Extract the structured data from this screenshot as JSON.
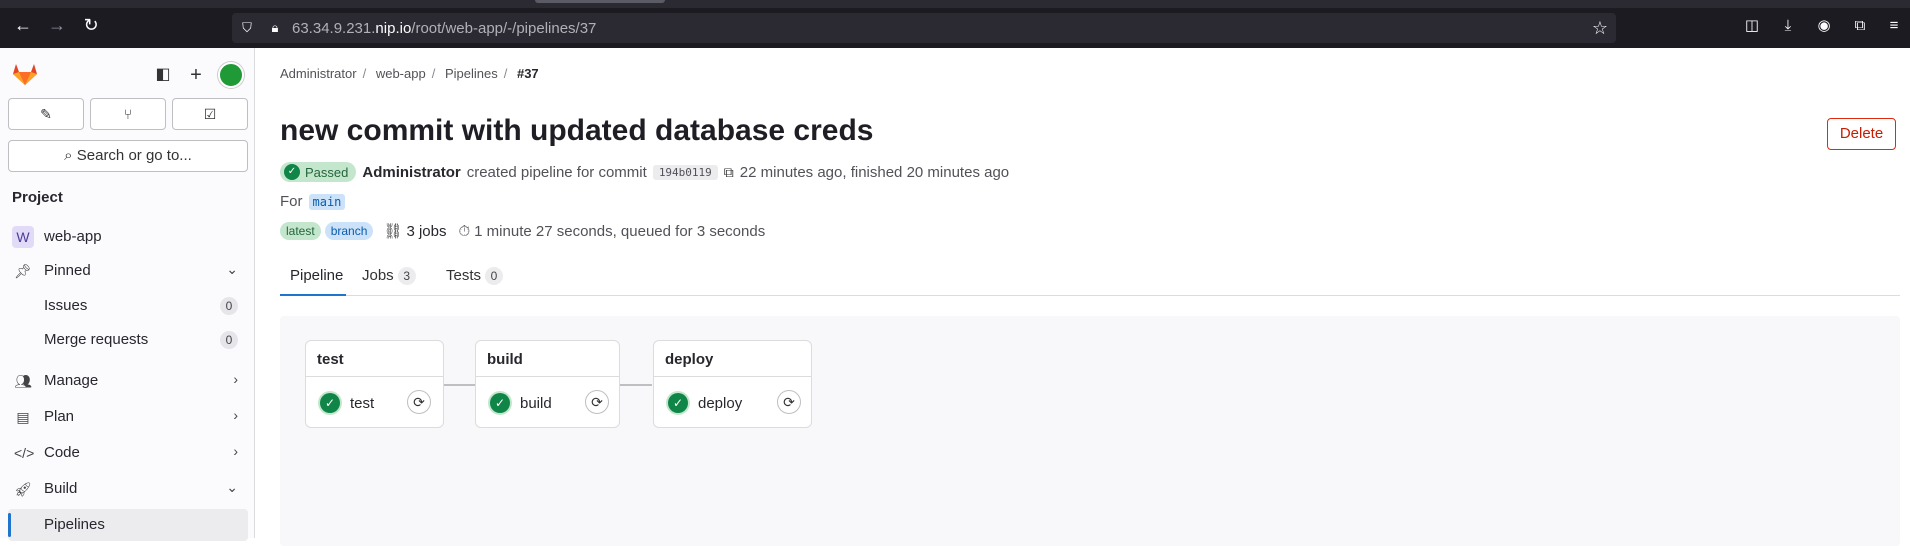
{
  "browser": {
    "url_prefix": "63.34.9.231.",
    "url_host": "nip.io",
    "url_path": "/root/web-app/-/pipelines/37"
  },
  "sidebar": {
    "search_label": "Search or go to...",
    "section_title": "Project",
    "project_avatar_letter": "W",
    "project_name": "web-app",
    "pinned_label": "Pinned",
    "issues_label": "Issues",
    "issues_count": "0",
    "merge_requests_label": "Merge requests",
    "merge_requests_count": "0",
    "manage_label": "Manage",
    "plan_label": "Plan",
    "code_label": "Code",
    "build_label": "Build",
    "pipelines_label": "Pipelines"
  },
  "breadcrumb": {
    "items": [
      "Administrator",
      "web-app",
      "Pipelines",
      "#37"
    ]
  },
  "pipeline": {
    "title": "new commit with updated database creds",
    "delete_label": "Delete",
    "status": "Passed",
    "author": "Administrator",
    "created_text": "created pipeline for commit",
    "sha": "194b0119",
    "timing": "22 minutes ago, finished 20 minutes ago",
    "for_label": "For",
    "ref": "main",
    "tag_latest": "latest",
    "tag_branch": "branch",
    "jobs_text": "3 jobs",
    "duration": "1 minute 27 seconds, queued for 3 seconds"
  },
  "tabs": [
    {
      "label": "Pipeline",
      "count": ""
    },
    {
      "label": "Jobs",
      "count": "3"
    },
    {
      "label": "Tests",
      "count": "0"
    }
  ],
  "stages": [
    {
      "name": "test",
      "job": "test"
    },
    {
      "name": "build",
      "job": "build"
    },
    {
      "name": "deploy",
      "job": "deploy"
    }
  ],
  "colors": {
    "accent": "#1f75cb",
    "success": "#108548",
    "danger": "#dd2b0e"
  }
}
